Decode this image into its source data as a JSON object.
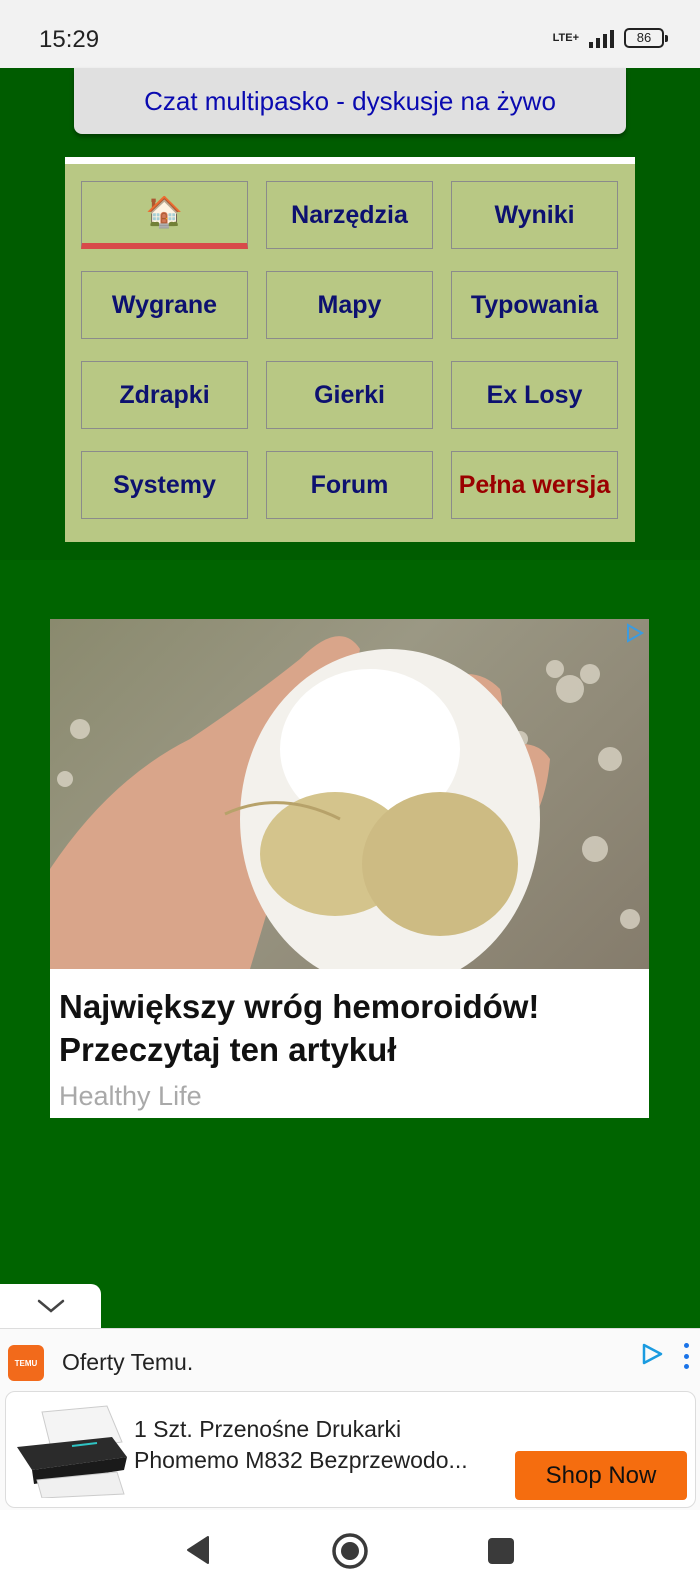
{
  "status": {
    "time": "15:29",
    "network": "LTE+",
    "battery": "86"
  },
  "chat": {
    "label": "Czat multipasko - dyskusje na żywo"
  },
  "menu": {
    "home_icon": "🏠",
    "items": [
      {
        "label": "Narzędzia"
      },
      {
        "label": "Wyniki"
      },
      {
        "label": "Wygrane"
      },
      {
        "label": "Mapy"
      },
      {
        "label": "Typowania"
      },
      {
        "label": "Zdrapki"
      },
      {
        "label": "Gierki"
      },
      {
        "label": "Ex Losy"
      },
      {
        "label": "Systemy"
      },
      {
        "label": "Forum"
      },
      {
        "label": "Pełna wersja"
      }
    ]
  },
  "ad": {
    "headline": "Największy wróg hemoroidów! Przeczytaj ten artykuł",
    "source": "Healthy Life"
  },
  "bottom_ad": {
    "brand_logo_text": "TEMU",
    "title": "Oferty Temu.",
    "product_line1": "1 Szt. Przenośne Drukarki",
    "product_line2": "Phomemo M832 Bezprzewodo...",
    "cta": "Shop Now"
  },
  "colors": {
    "green_bg": "#006400",
    "menu_panel": "#b8c884",
    "menu_text": "#0d1170",
    "highlight_text": "#9a0000",
    "chat_text": "#0a0ab0",
    "cta_orange": "#f56d0f"
  }
}
